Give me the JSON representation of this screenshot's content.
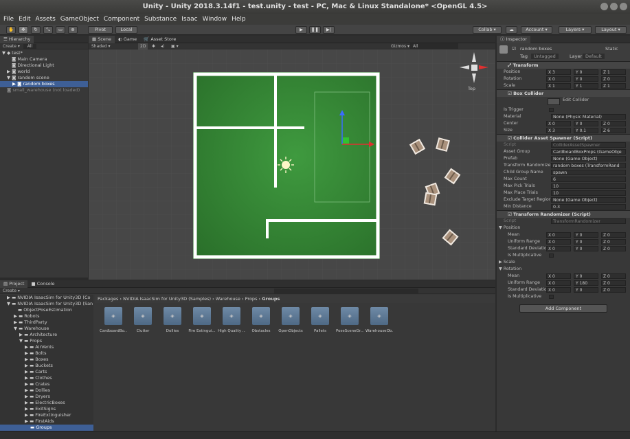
{
  "window": {
    "title": "Unity - Unity 2018.3.14f1 - test.unity - test - PC, Mac & Linux Standalone* <OpenGL 4.5>"
  },
  "menu": [
    "File",
    "Edit",
    "Assets",
    "GameObject",
    "Component",
    "Substance",
    "Isaac",
    "Window",
    "Help"
  ],
  "toolbar": {
    "pivot": "Pivot",
    "local": "Local",
    "collab": "Collab",
    "account": "Account",
    "layers": "Layers",
    "layout": "Layout"
  },
  "hierarchy": {
    "tab": "Hierarchy",
    "create": "Create",
    "search": "All",
    "scene": "test*",
    "items": [
      "Main Camera",
      "Directional Light",
      "world",
      "random scene",
      "random boxes",
      "small_warehouse (not loaded)"
    ]
  },
  "scene": {
    "tabs": [
      "Scene",
      "Game",
      "Asset Store"
    ],
    "shading": "Shaded",
    "mode": "2D",
    "gizmos": "Gizmos",
    "search": "All",
    "view_label": "Top"
  },
  "project": {
    "tabs": [
      "Project",
      "Console"
    ],
    "create": "Create",
    "tree": [
      "NVIDIA IsaacSim for Unity3D (Co",
      "NVIDIA IsaacSim for Unity3D (San",
      "ObjectPoseEstimation",
      "Robots",
      "ThirdParty",
      "Warehouse",
      "Architecture",
      "Props",
      "AirVents",
      "Bolts",
      "Boxes",
      "Buckets",
      "Carts",
      "Clothes",
      "Crates",
      "Dollies",
      "Dryers",
      "ElectricBoxes",
      "ExitSigns",
      "FireExtinguisher",
      "FirstAids",
      "Groups"
    ],
    "breadcrumb": [
      "Packages",
      "NVIDIA IsaacSim for Unity3D (Samples)",
      "Warehouse",
      "Props",
      "Groups"
    ],
    "assets": [
      "CardboardBo...",
      "Clutter",
      "Dollies",
      "Fire Extingui...",
      "High Quality ...",
      "Obstacles",
      "OpenObjects",
      "Pallets",
      "PoseSceneGr...",
      "WarehouseOb..."
    ]
  },
  "inspector": {
    "tab": "Inspector",
    "object_name": "random boxes",
    "static": "Static",
    "tag_label": "Tag",
    "tag": "Untagged",
    "layer_label": "Layer",
    "layer": "Default",
    "transform": {
      "title": "Transform",
      "rows": [
        {
          "label": "Position",
          "x": "X 3",
          "y": "Y 0",
          "z": "Z 1"
        },
        {
          "label": "Rotation",
          "x": "X 0",
          "y": "Y 0",
          "z": "Z 0"
        },
        {
          "label": "Scale",
          "x": "X 1",
          "y": "Y 1",
          "z": "Z 1"
        }
      ]
    },
    "box_collider": {
      "title": "Box Collider",
      "edit": "Edit Collider",
      "rows": [
        {
          "label": "Is Trigger",
          "val": ""
        },
        {
          "label": "Material",
          "val": "None (Physic Material)"
        }
      ],
      "center": {
        "label": "Center",
        "x": "X 0",
        "y": "Y 0",
        "z": "Z 0"
      },
      "size": {
        "label": "Size",
        "x": "X 3",
        "y": "Y 0.1",
        "z": "Z 6"
      }
    },
    "spawner": {
      "title": "Collider Asset Spawner (Script)",
      "rows": [
        {
          "label": "Script",
          "val": "ColliderAssetSpawner"
        },
        {
          "label": "Asset Group",
          "val": "CardboardBoxProps (GameObje"
        },
        {
          "label": "Prefab",
          "val": "None (Game Object)"
        },
        {
          "label": "Transform Randomize",
          "val": "random boxes (TransformRand"
        },
        {
          "label": "Child Group Name",
          "val": "spawn"
        },
        {
          "label": "Max Count",
          "val": "6"
        },
        {
          "label": "Max Pick Trials",
          "val": "10"
        },
        {
          "label": "Max Place Trials",
          "val": "10"
        },
        {
          "label": "Exclude Target Regior",
          "val": "None (Game Object)"
        },
        {
          "label": "Min Distance",
          "val": "0.3"
        }
      ]
    },
    "randomizer": {
      "title": "Transform Randomizer (Script)",
      "script_label": "Script",
      "script": "TransformRandomizer",
      "position": "Position",
      "mean": "Mean",
      "uniform": "Uniform Range",
      "stddev": "Standard Deviation",
      "mult": "Is Multiplicative",
      "scale": "Scale",
      "rotation": "Rotation",
      "pos_mean": {
        "x": "X 0",
        "y": "Y 0",
        "z": "Z 0"
      },
      "pos_uni": {
        "x": "X 0",
        "y": "Y 0",
        "z": "Z 0"
      },
      "pos_std": {
        "x": "X 0",
        "y": "Y 0",
        "z": "Z 0"
      },
      "rot_mean": {
        "x": "X 0",
        "y": "Y 0",
        "z": "Z 0"
      },
      "rot_uni": {
        "x": "X 0",
        "y": "Y 180",
        "z": "Z 0"
      },
      "rot_std": {
        "x": "X 0",
        "y": "Y 0",
        "z": "Z 0"
      }
    },
    "add_component": "Add Component"
  }
}
